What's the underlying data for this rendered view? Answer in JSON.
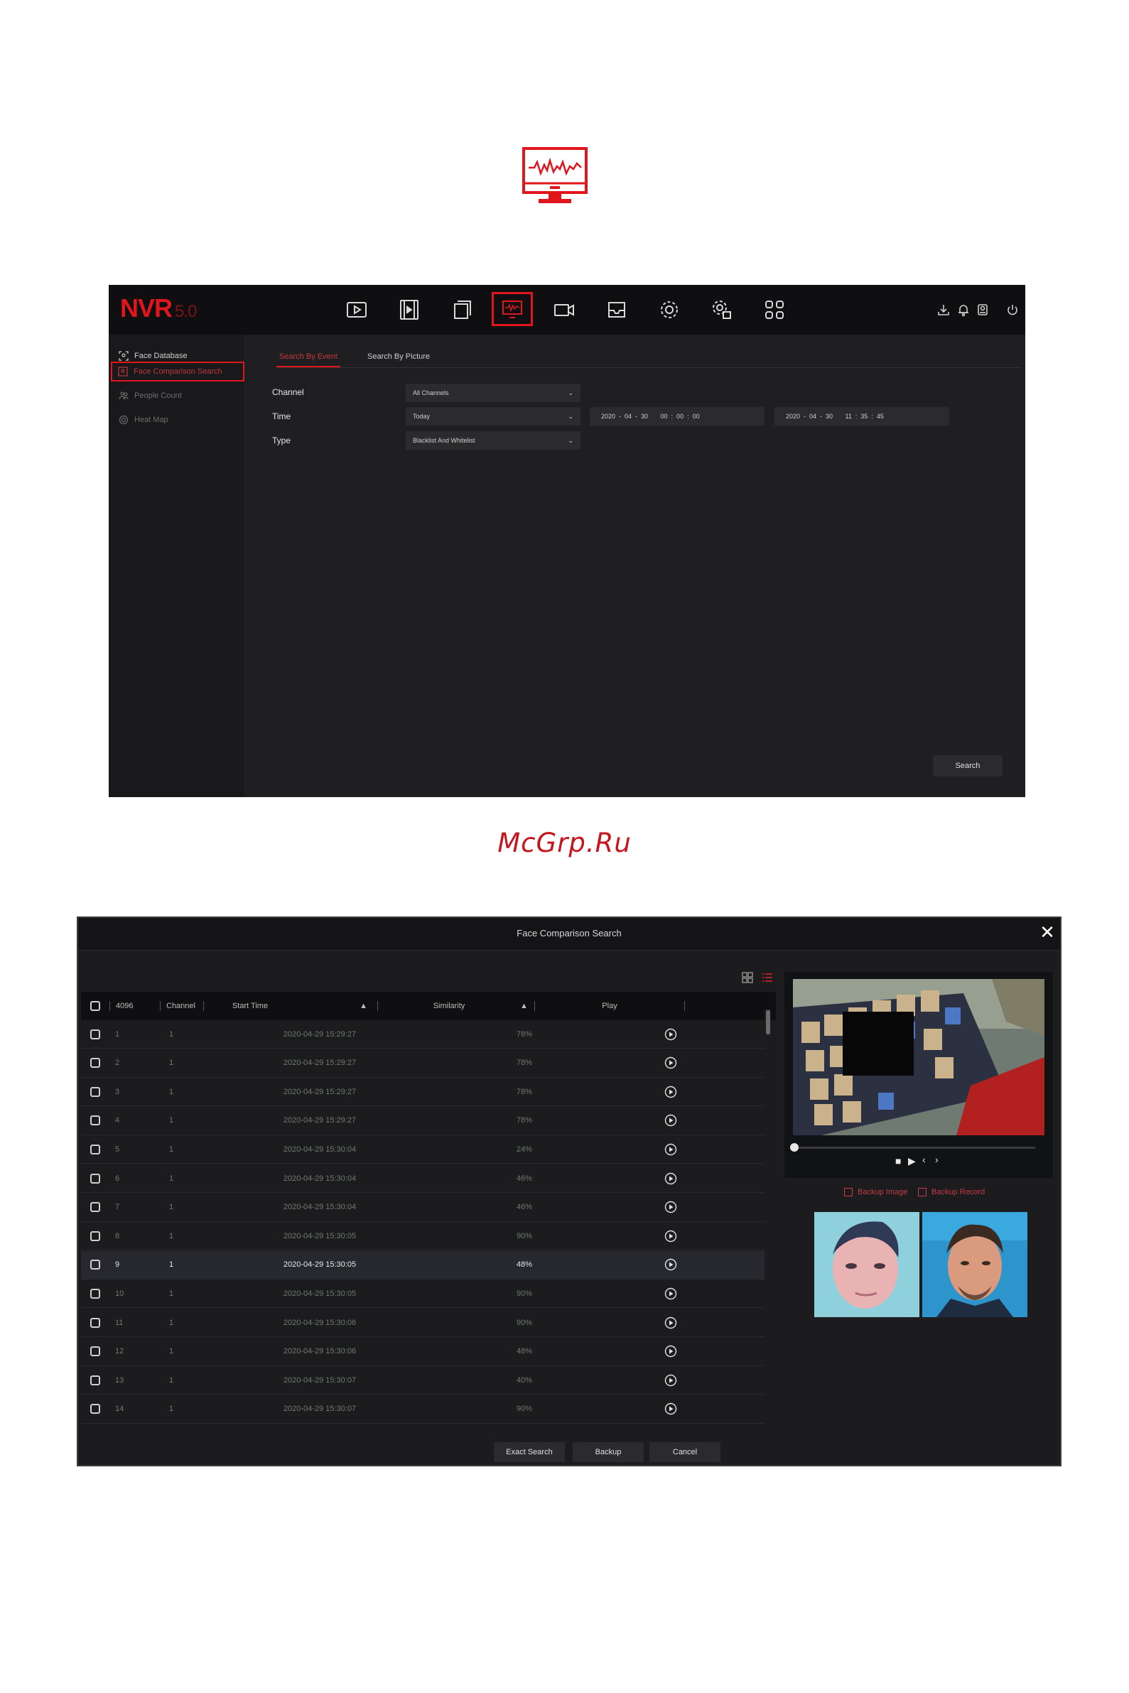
{
  "nvr": {
    "logo": "NVR",
    "version": "5.0",
    "sidebar": [
      "Face Database",
      "Face Comparison Search",
      "People Count",
      "Heat Map"
    ],
    "tabs": [
      "Search By Event",
      "Search By Picture"
    ],
    "form": {
      "channel_label": "Channel",
      "channel_value": "All Channels",
      "time_label": "Time",
      "time_value": "Today",
      "start_date": "2020  -  04  -  30       00  :  00  :  00",
      "end_date": "2020  -  04  -  30       11  :  35  :  45",
      "type_label": "Type",
      "type_value": "Blacklist And Whitelist"
    },
    "search_button": "Search"
  },
  "brand": "McGrp.Ru",
  "dialog": {
    "title": "Face Comparison Search",
    "close": "✕",
    "headers": {
      "count": "4096",
      "channel": "Channel",
      "start_time": "Start Time",
      "similarity": "Similarity",
      "play": "Play"
    },
    "rows": [
      {
        "idx": "1",
        "ch": "1",
        "time": "2020-04-29 15:29:27",
        "sim": "78%"
      },
      {
        "idx": "2",
        "ch": "1",
        "time": "2020-04-29 15:29:27",
        "sim": "78%"
      },
      {
        "idx": "3",
        "ch": "1",
        "time": "2020-04-29 15:29:27",
        "sim": "78%"
      },
      {
        "idx": "4",
        "ch": "1",
        "time": "2020-04-29 15:29:27",
        "sim": "78%"
      },
      {
        "idx": "5",
        "ch": "1",
        "time": "2020-04-29 15:30:04",
        "sim": "24%"
      },
      {
        "idx": "6",
        "ch": "1",
        "time": "2020-04-29 15:30:04",
        "sim": "46%"
      },
      {
        "idx": "7",
        "ch": "1",
        "time": "2020-04-29 15:30:04",
        "sim": "46%"
      },
      {
        "idx": "8",
        "ch": "1",
        "time": "2020-04-29 15:30:05",
        "sim": "90%"
      },
      {
        "idx": "9",
        "ch": "1",
        "time": "2020-04-29 15:30:05",
        "sim": "48%"
      },
      {
        "idx": "10",
        "ch": "1",
        "time": "2020-04-29 15:30:05",
        "sim": "90%"
      },
      {
        "idx": "11",
        "ch": "1",
        "time": "2020-04-29 15:30:06",
        "sim": "90%"
      },
      {
        "idx": "12",
        "ch": "1",
        "time": "2020-04-29 15:30:06",
        "sim": "48%"
      },
      {
        "idx": "13",
        "ch": "1",
        "time": "2020-04-29 15:30:07",
        "sim": "40%"
      },
      {
        "idx": "14",
        "ch": "1",
        "time": "2020-04-29 15:30:07",
        "sim": "90%"
      }
    ],
    "selected_row": 8,
    "backup_image": "Backup Image",
    "backup_record": "Backup Record",
    "buttons": {
      "exact": "Exact Search",
      "backup": "Backup",
      "cancel": "Cancel"
    }
  },
  "colors": {
    "accent": "#e1151c",
    "bg": "#1f1f22"
  }
}
